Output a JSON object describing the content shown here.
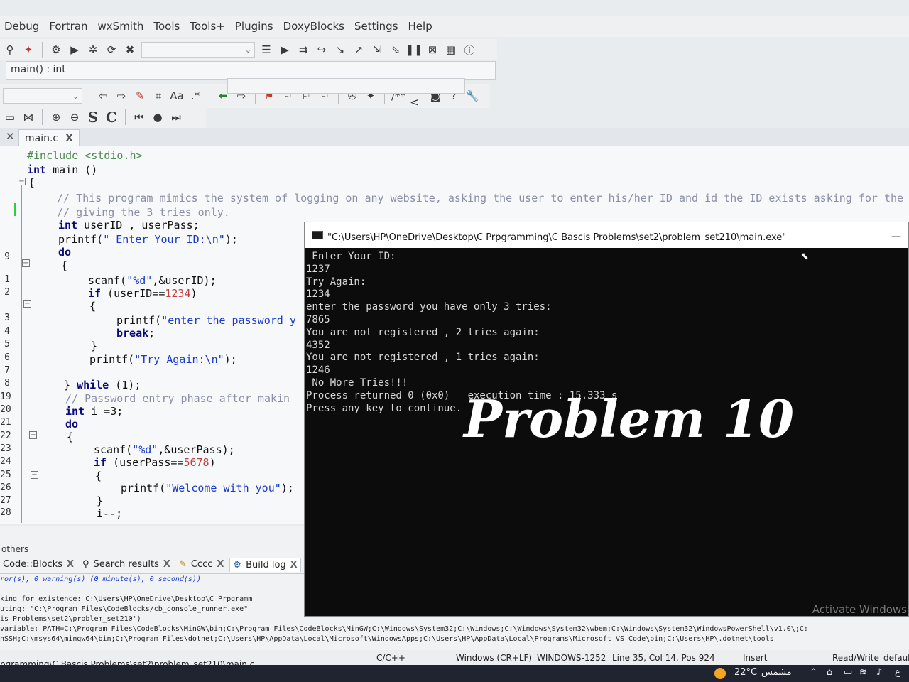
{
  "menu": [
    "Debug",
    "Fortran",
    "wxSmith",
    "Tools",
    "Tools+",
    "Plugins",
    "DoxyBlocks",
    "Settings",
    "Help"
  ],
  "function_bar": "main() : int",
  "editor_tab": {
    "label": "main.c",
    "close": "X"
  },
  "gutter": [
    "",
    "",
    "",
    "",
    "",
    "",
    "",
    "",
    "9",
    "",
    "1",
    "2",
    "3",
    "4",
    "5",
    "6",
    "7",
    "8",
    "19",
    "20",
    "21",
    "22",
    "23",
    "24",
    "25",
    "26",
    "27",
    "28"
  ],
  "code": {
    "l1": "#include <stdio.h>",
    "l2_kw": "int",
    "l2_rest": " main ()",
    "l3": "{",
    "l4": "// This program mimics the system of logging on any website, asking the user to enter his/her ID and id the ID exists asking for the",
    "l5": "// giving the 3 tries only.",
    "l6_kw": "int",
    "l6_rest": " userID , userPass;",
    "l7_a": "printf(",
    "l7_str": "\" Enter Your ID:\\n\"",
    "l7_b": ");",
    "l8_kw": "do",
    "l9": "{",
    "l10_a": "scanf(",
    "l10_str": "\"%d\"",
    "l10_b": ",&userID);",
    "l11_kw": "if",
    "l11_a": " (userID==",
    "l11_num": "1234",
    "l11_b": ")",
    "l12": "{",
    "l13_a": "printf(",
    "l13_str": "\"enter the password y",
    "l14_kw": "break",
    "l14_b": ";",
    "l15": "}",
    "l16_a": "printf(",
    "l16_str": "\"Try Again:\\n\"",
    "l16_b": ");",
    "l17_a": "} ",
    "l17_kw": "while",
    "l17_b": " (1);",
    "l18": "// Password entry phase after makin",
    "l19_kw": "int",
    "l19_b": " i =3;",
    "l20_kw": "do",
    "l21": "{",
    "l22_a": "scanf(",
    "l22_str": "\"%d\"",
    "l22_b": ",&userPass);",
    "l23_kw": "if",
    "l23_a": " (userPass==",
    "l23_num": "5678",
    "l23_b": ")",
    "l24": "{",
    "l25_a": "printf(",
    "l25_str": "\"Welcome with you\"",
    "l25_b": ");",
    "l26": "}",
    "l27": "i--;"
  },
  "log_panel": {
    "others_label": "others",
    "tabs": [
      {
        "label": "Code::Blocks",
        "close": "X"
      },
      {
        "label": "Search results",
        "close": "X"
      },
      {
        "label": "Cccc",
        "close": "X"
      },
      {
        "label": "Build log",
        "close": "X"
      }
    ],
    "lines": [
      "ror(s), 0 warning(s) (0 minute(s), 0 second(s))",
      "king for existence: C:\\Users\\HP\\OneDrive\\Desktop\\C Prpgramm",
      "uting: \"C:\\Program Files\\CodeBlocks/cb_console_runner.exe\"",
      "is Problems\\set2\\problem_set210')",
      "variable: PATH=C:\\Program Files\\CodeBlocks\\MinGW\\bin;C:\\Program Files\\CodeBlocks\\MinGW;C:\\Windows\\System32;C:\\Windows;C:\\Windows\\System32\\wbem;C:\\Windows\\System32\\WindowsPowerShell\\v1.0\\;C:",
      "nSSH;C:\\msys64\\mingw64\\bin;C:\\Program Files\\dotnet;C:\\Users\\HP\\AppData\\Local\\Microsoft\\WindowsApps;C:\\Users\\HP\\AppData\\Local\\Programs\\Microsoft VS Code\\bin;C:\\Users\\HP\\.dotnet\\tools"
    ]
  },
  "status": {
    "path": "pgramming\\C Bascis Problems\\set2\\problem_set210\\main.c",
    "lang": "C/C++",
    "eol": "Windows (CR+LF)",
    "encoding": "WINDOWS-1252",
    "position": "Line 35, Col 14, Pos 924",
    "mode": "Insert",
    "access": "Read/Write",
    "extra": "default"
  },
  "taskbar": {
    "temp": "22°C",
    "weather": "مشمس",
    "lang": "ع"
  },
  "console": {
    "title": "\"C:\\Users\\HP\\OneDrive\\Desktop\\C Prpgramming\\C Bascis Problems\\set2\\problem_set210\\main.exe\"",
    "lines": [
      " Enter Your ID:",
      "1237",
      "Try Again:",
      "1234",
      "enter the password you have only 3 tries:",
      "7865",
      "You are not registered , 2 tries again:",
      "4352",
      "You are not registered , 1 tries again:",
      "1246",
      " No More Tries!!!",
      "Process returned 0 (0x0)   execution time : 15.333 s",
      "Press any key to continue."
    ],
    "caption": "Problem 10",
    "watermark": "Activate Windows"
  }
}
